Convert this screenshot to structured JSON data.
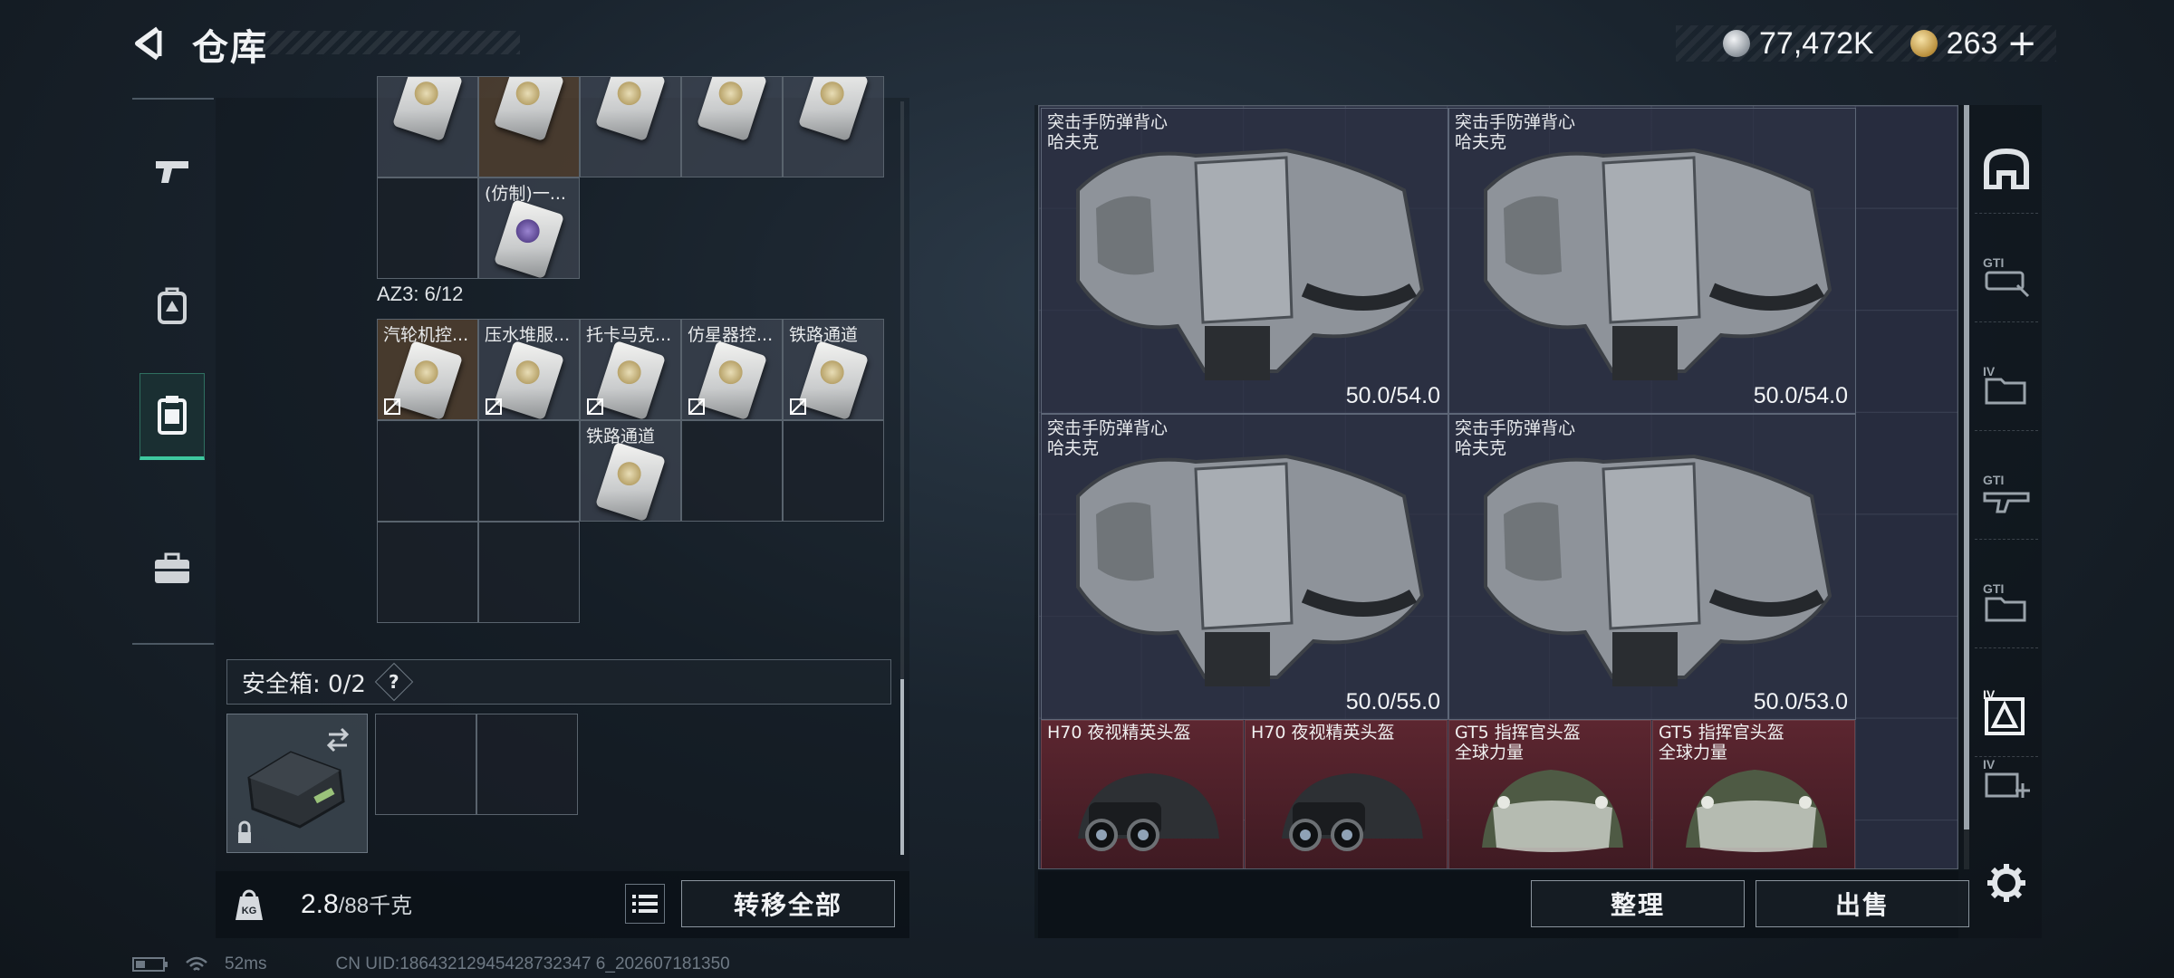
{
  "header": {
    "title": "仓库"
  },
  "currency": {
    "silver_value": "77,472K",
    "gold_value": "263",
    "plus": "+"
  },
  "left_rail": {
    "items": [
      {
        "icon": "pistol-icon",
        "active": false
      },
      {
        "icon": "backpack-icon",
        "active": false
      },
      {
        "icon": "container-icon",
        "active": true
      },
      {
        "icon": "briefcase-icon",
        "active": false
      }
    ]
  },
  "inventory": {
    "top_partial_row": [
      "",
      "",
      "",
      "",
      ""
    ],
    "top_row2_label": "(仿制)一...",
    "section_title": "AZ3: 6/12",
    "az3_row1": [
      "汽轮机控...",
      "压水堆服...",
      "托卡马克...",
      "仿星器控...",
      "铁路通道"
    ],
    "az3_row2_label": "铁路通道"
  },
  "safe_box": {
    "label": "安全箱: 0/2",
    "help": "?"
  },
  "weight": {
    "current": "2.8",
    "capacity": "/88千克"
  },
  "buttons": {
    "transfer_all": "转移全部",
    "organize": "整理",
    "sell": "出售"
  },
  "stash": {
    "vests": [
      {
        "line1": "突击手防弹背心",
        "line2": "哈夫克",
        "durability": "50.0/54.0"
      },
      {
        "line1": "突击手防弹背心",
        "line2": "哈夫克",
        "durability": "50.0/54.0"
      },
      {
        "line1": "突击手防弹背心",
        "line2": "哈夫克",
        "durability": "50.0/55.0"
      },
      {
        "line1": "突击手防弹背心",
        "line2": "哈夫克",
        "durability": "50.0/53.0"
      }
    ],
    "helmets": [
      {
        "line1": "H70 夜视精英头盔",
        "line2": ""
      },
      {
        "line1": "H70 夜视精英头盔",
        "line2": ""
      },
      {
        "line1": "GT5 指挥官头盔",
        "line2": "全球力量"
      },
      {
        "line1": "GT5 指挥官头盔",
        "line2": "全球力量"
      }
    ]
  },
  "filters": [
    "helmet-category-icon",
    "gti-weapon-icon",
    "tier4-folder-icon",
    "gti-rifle-icon",
    "gti-folder-icon",
    "tier4-vest-icon",
    "tier4-add-icon"
  ],
  "status_bar": {
    "ping": "52ms",
    "uid": "CN UID:18643212945428732347 6_202607181350"
  },
  "colors": {
    "accent": "#3ec9a0",
    "helmet_bg": "#5c2630",
    "item_highlight": "#5c4630"
  }
}
